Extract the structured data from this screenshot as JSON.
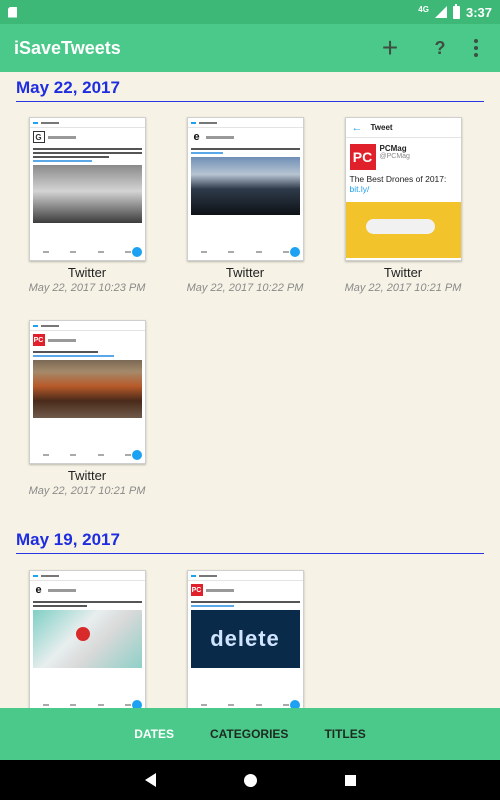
{
  "status_bar": {
    "network": "4G",
    "time": "3:37"
  },
  "app_bar": {
    "title": "iSaveTweets",
    "add_label": "+",
    "help_label": "?"
  },
  "sections": [
    {
      "date": "May 22, 2017",
      "items": [
        {
          "title": "Twitter",
          "date": "May 22, 2017 10:23 PM",
          "thumb": "bw-portrait"
        },
        {
          "title": "Twitter",
          "date": "May 22, 2017 10:22 PM",
          "thumb": "car-dashboard"
        },
        {
          "title": "Twitter",
          "date": "May 22, 2017 10:21 PM",
          "thumb": "pcmag-drone",
          "preview": {
            "header": "Tweet",
            "name": "PCMag",
            "handle": "@PCMag",
            "logo": "PC",
            "text": "The Best Drones of 2017:",
            "link": "bit.ly/"
          }
        },
        {
          "title": "Twitter",
          "date": "May 22, 2017 10:21 PM",
          "thumb": "tv-money"
        }
      ]
    },
    {
      "date": "May 19, 2017",
      "items": [
        {
          "title": "",
          "date": "",
          "thumb": "beats-headphones"
        },
        {
          "title": "",
          "date": "",
          "thumb": "delete-key",
          "preview": {
            "image_text": "delete"
          }
        }
      ]
    }
  ],
  "tabs": {
    "dates": "DATES",
    "categories": "CATEGORIES",
    "titles": "TITLES",
    "active": "dates"
  },
  "colors": {
    "status_bar": "#3db877",
    "app_bar": "#4bc98a",
    "date_header": "#1f2de0",
    "background": "#f6f3e6",
    "twitter_blue": "#1da1f2",
    "pcmag_red": "#e0212b"
  }
}
